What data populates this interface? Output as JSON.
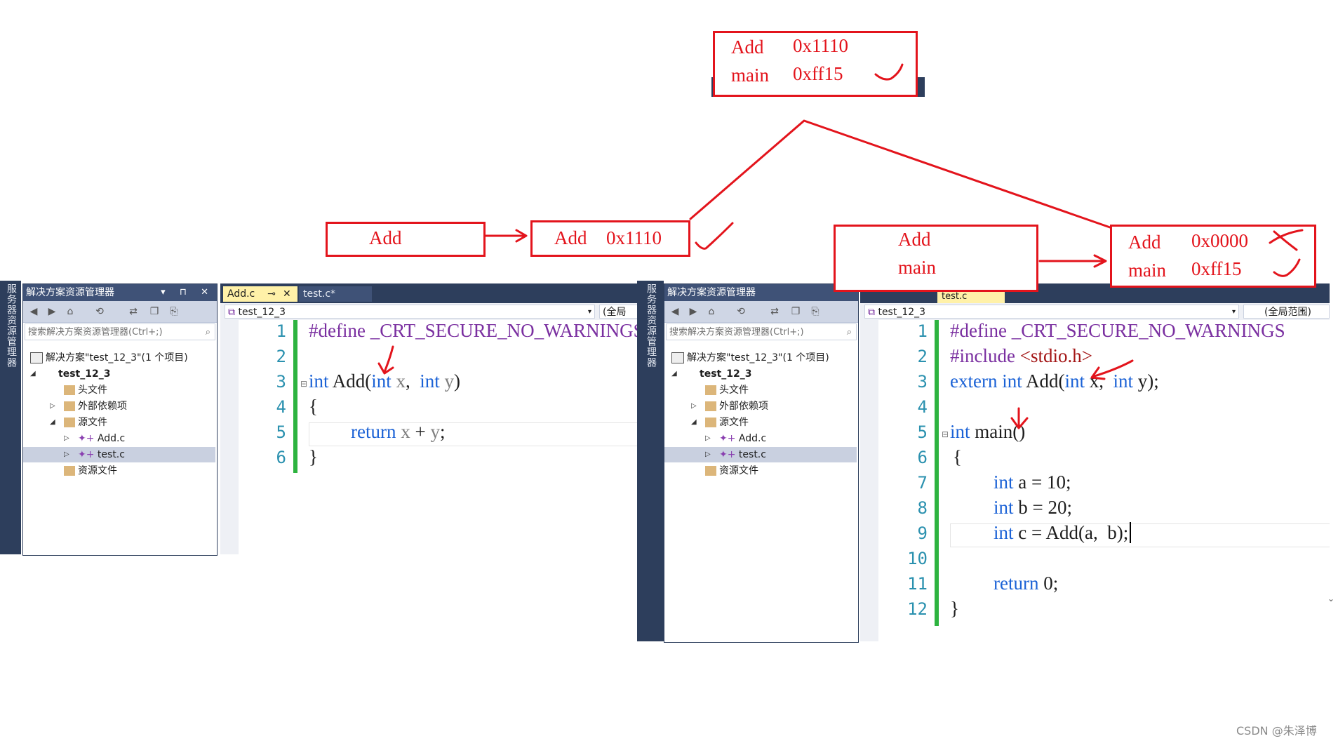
{
  "explorer": {
    "side_tab": "服务器资源管理器",
    "title": "解决方案资源管理器",
    "search_placeholder": "搜索解决方案资源管理器(Ctrl+;)",
    "items": [
      {
        "label": "解决方案\"test_12_3\"(1 个项目)"
      },
      {
        "label": "test_12_3"
      },
      {
        "label": "头文件"
      },
      {
        "label": "外部依赖项"
      },
      {
        "label": "源文件"
      },
      {
        "label": "Add.c"
      },
      {
        "label": "test.c"
      },
      {
        "label": "资源文件"
      }
    ]
  },
  "left_editor": {
    "tabs": [
      {
        "label": "Add.c"
      },
      {
        "label": "test.c*"
      }
    ],
    "project_dropdown": "test_12_3",
    "scope_dropdown": "(全局",
    "lines": [
      "1",
      "2",
      "3",
      "4",
      "5",
      "6"
    ],
    "code": {
      "l1a": "#define",
      "l1b": " _CRT_SECURE_NO_WARNINGS",
      "l3a": "int",
      "l3b": " Add(",
      "l3c": "int",
      "l3d": " x",
      "l3e": ",  ",
      "l3f": "int",
      "l3g": " y",
      "l3h": ")",
      "l4": "{",
      "l5a": "return",
      "l5b": " x",
      "l5c": " + ",
      "l5d": "y",
      "l5e": ";",
      "l6": "}"
    }
  },
  "right_editor": {
    "tab_label": "test.c",
    "project_dropdown": "test_12_3",
    "scope_dropdown": "(全局范围)",
    "lines": [
      "1",
      "2",
      "3",
      "4",
      "5",
      "6",
      "7",
      "8",
      "9",
      "10",
      "11",
      "12"
    ],
    "code": {
      "l1a": "#define",
      "l1b": " _CRT_SECURE_NO_WARNINGS",
      "l2a": "#include",
      "l2b": " <stdio.h>",
      "l3a": "extern",
      "l3b": " int",
      "l3c": " Add(",
      "l3d": "int",
      "l3e": " x,  ",
      "l3f": "int",
      "l3g": " y);",
      "l5a": "int",
      "l5b": " main()",
      "l6": "{",
      "l7a": "int",
      "l7b": " a = 10;",
      "l8a": "int",
      "l8b": " b = 20;",
      "l9a": "int",
      "l9b": " c = Add(a,  b);",
      "l11a": "return",
      "l11b": " 0;",
      "l12": "}"
    }
  },
  "annotations": {
    "top_box": {
      "line1_name": "Add",
      "line1_addr": "0x1110",
      "line2_name": "main",
      "line2_addr": "0xff15"
    },
    "left_symbol": "Add",
    "left_table": {
      "name": "Add",
      "addr": "0x1110"
    },
    "right_symbols": {
      "line1": "Add",
      "line2": "main"
    },
    "right_table": {
      "line1_name": "Add",
      "line1_addr": "0x0000",
      "line2_name": "main",
      "line2_addr": "0xff15"
    }
  },
  "watermark": "CSDN @朱泽博",
  "colors": {
    "annotation_red": "#e3141c",
    "ide_dark": "#2d3e5c",
    "keyword_blue": "#1b62d6",
    "preprocessor_purple": "#7a2fa0",
    "line_number_teal": "#2b91af"
  }
}
